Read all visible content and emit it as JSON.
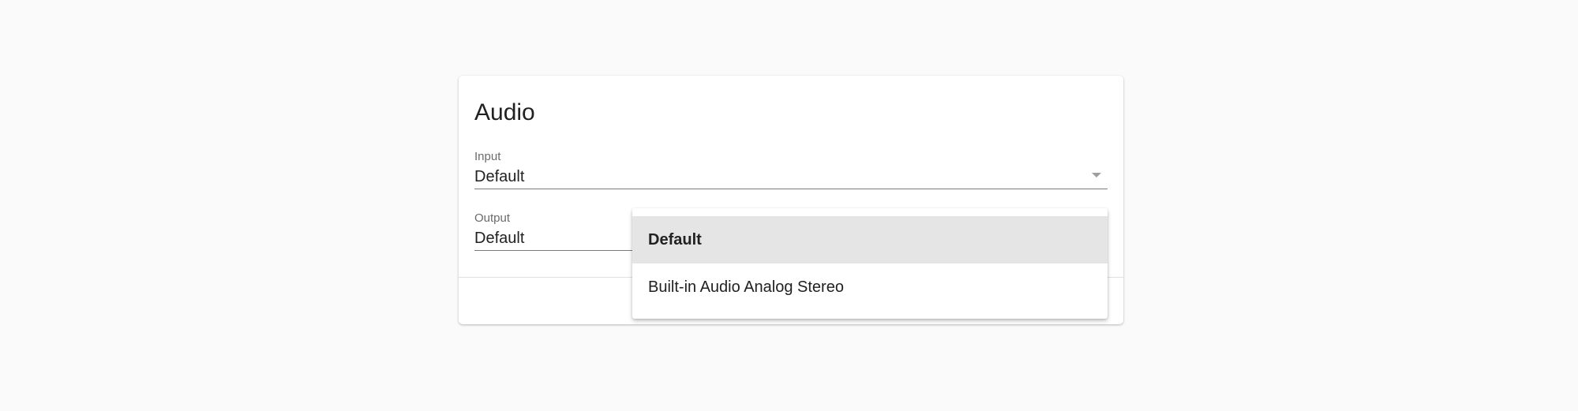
{
  "card": {
    "title": "Audio"
  },
  "fields": {
    "input": {
      "label": "Input",
      "value": "Default"
    },
    "output": {
      "label": "Output",
      "value": "Default"
    }
  },
  "menu": {
    "items": [
      {
        "label": "Default",
        "selected": true
      },
      {
        "label": "Built-in Audio Analog Stereo",
        "selected": false
      }
    ]
  },
  "colors": {
    "background": "#fafafa",
    "card": "#ffffff",
    "selected_item": "#e5e5e5",
    "text": "#212121",
    "label": "#6b6b6b"
  },
  "icons": {
    "input_dropdown": "dropdown-arrow-icon"
  }
}
